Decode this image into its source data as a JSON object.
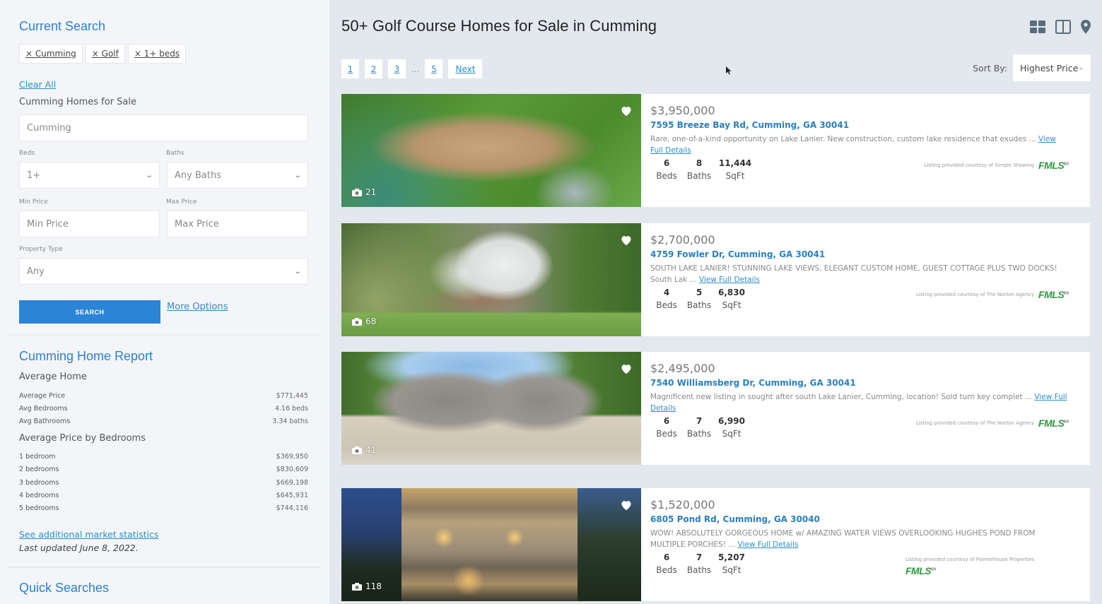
{
  "sidebar": {
    "current_search_title": "Current Search",
    "chips": [
      "× Cumming",
      "× Golf",
      "× 1+ beds"
    ],
    "clear_all": "Clear All",
    "homes_for_sale_label": "Cumming Homes for Sale",
    "location_input": {
      "value": "Cumming",
      "placeholder": "Cumming"
    },
    "beds": {
      "label": "Beds",
      "value": "1+"
    },
    "baths": {
      "label": "Baths",
      "value": "Any Baths"
    },
    "min_price": {
      "label": "Min Price",
      "placeholder": "Min Price"
    },
    "max_price": {
      "label": "Max Price",
      "placeholder": "Max Price"
    },
    "property_type": {
      "label": "Property Type",
      "value": "Any"
    },
    "search_button": "SEARCH",
    "more_options": "More Options",
    "report": {
      "title": "Cumming Home Report",
      "average_home_heading": "Average Home",
      "average_home": [
        {
          "label": "Average Price",
          "value": "$771,445"
        },
        {
          "label": "Avg Bedrooms",
          "value": "4.16 beds"
        },
        {
          "label": "Avg Bathrooms",
          "value": "3.34 baths"
        }
      ],
      "by_bedrooms_heading": "Average Price by Bedrooms",
      "by_bedrooms": [
        {
          "label": "1 bedroom",
          "value": "$369,950"
        },
        {
          "label": "2 bedrooms",
          "value": "$830,609"
        },
        {
          "label": "3 bedrooms",
          "value": "$669,198"
        },
        {
          "label": "4 bedrooms",
          "value": "$645,931"
        },
        {
          "label": "5 bedrooms",
          "value": "$744,116"
        }
      ],
      "market_stats_link": "See additional market statistics",
      "last_updated": "Last updated June 8, 2022."
    },
    "quick_searches_title": "Quick Searches"
  },
  "main": {
    "title": "50+ Golf Course Homes for Sale in Cumming",
    "view_icons": [
      "grid-view-icon",
      "split-view-icon",
      "map-view-icon"
    ],
    "pagination": {
      "pages": [
        "1",
        "2",
        "3",
        "5"
      ],
      "ellipsis": "...",
      "next": "Next",
      "current": "1"
    },
    "sort": {
      "label": "Sort By:",
      "value": "Highest Price"
    },
    "listings": [
      {
        "price": "$3,950,000",
        "address": "7595 Breeze Bay Rd, Cumming, GA 30041",
        "description": "Rare, one-of-a-kind opportunity on Lake Lanier. New construction, custom lake residence that exudes ...",
        "view_link": "View Full Details",
        "beds": "6",
        "baths": "8",
        "sqft": "11,444",
        "beds_label": "Beds",
        "baths_label": "Baths",
        "sqft_label": "SqFt",
        "photo_count": "21",
        "courtesy": "Listing provided courtesy of Simple Showing",
        "mls": "FMLS",
        "mls_sup": "IDX"
      },
      {
        "price": "$2,700,000",
        "address": "4759 Fowler Dr, Cumming, GA 30041",
        "description": "SOUTH LAKE LANIER! STUNNING LAKE VIEWS, ELEGANT CUSTOM HOME, GUEST COTTAGE PLUS TWO DOCKS! South Lak ...",
        "view_link": "View Full Details",
        "beds": "4",
        "baths": "5",
        "sqft": "6,830",
        "beds_label": "Beds",
        "baths_label": "Baths",
        "sqft_label": "SqFt",
        "photo_count": "68",
        "courtesy": "Listing provided courtesy of The Norton Agency",
        "mls": "FMLS",
        "mls_sup": "IDX"
      },
      {
        "price": "$2,495,000",
        "address": "7540 Williamsberg Dr, Cumming, GA 30041",
        "description": "Magnificent new listing in sought after south Lake Lanier, Cumming, location! Sold turn key complet ...",
        "view_link": "View Full Details",
        "beds": "6",
        "baths": "7",
        "sqft": "6,990",
        "beds_label": "Beds",
        "baths_label": "Baths",
        "sqft_label": "SqFt",
        "photo_count": "41",
        "courtesy": "Listing provided courtesy of The Norton Agency",
        "mls": "FMLS",
        "mls_sup": "IDX"
      },
      {
        "price": "$1,520,000",
        "address": "6805 Pond Rd, Cumming, GA 30040",
        "description": "WOW! ABSOLUTELY GORGEOUS HOME w/ AMAZING WATER VIEWS OVERLOOKING HUGHES POND FROM MULTIPLE PORCHES! ...",
        "view_link": "View Full Details",
        "beds": "6",
        "baths": "7",
        "sqft": "5,207",
        "beds_label": "Beds",
        "baths_label": "Baths",
        "sqft_label": "SqFt",
        "photo_count": "118",
        "courtesy": "Listing provided courtesy of Palmerhouse Properties",
        "mls": "FMLS",
        "mls_sup": "IDX"
      }
    ]
  },
  "colors": {
    "accent_blue": "#2e7fd3",
    "link_blue": "#2a8fc9",
    "search_button": "#2b84d6",
    "fmls_green": "#2d9a3e"
  }
}
